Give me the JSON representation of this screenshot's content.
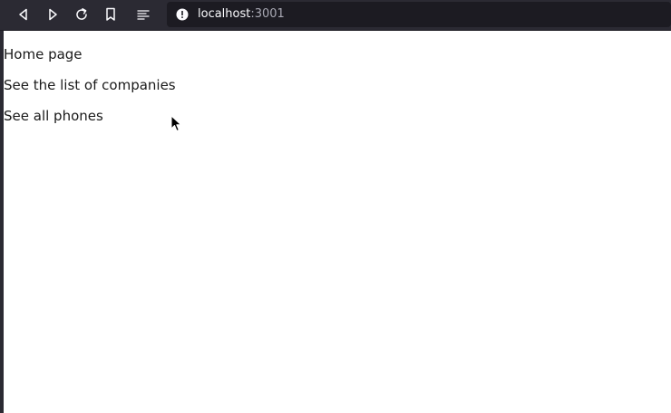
{
  "browser": {
    "nav_icons": {
      "back": "back-arrow-icon",
      "forward": "forward-arrow-icon",
      "reload": "reload-icon",
      "bookmark": "bookmark-icon",
      "reader": "reader-view-icon",
      "site_info": "site-info-icon"
    },
    "url": {
      "host": "localhost",
      "port": ":3001"
    },
    "colors": {
      "toolbar": "#2b2a33",
      "urlbar": "#1c1b22",
      "icon": "#fbfbfe"
    }
  },
  "page": {
    "links": [
      "Home page",
      "See the list of companies",
      "See all phones"
    ]
  },
  "cursor": {
    "icon": "mouse-pointer-icon"
  }
}
